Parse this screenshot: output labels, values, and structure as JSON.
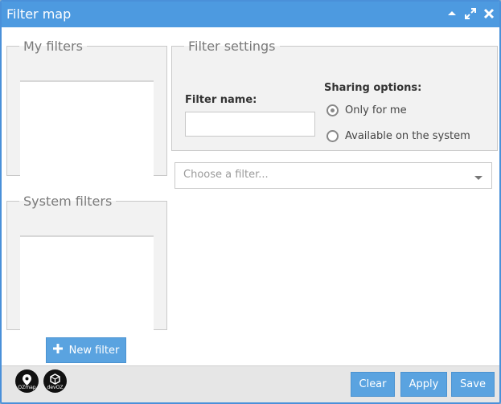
{
  "window": {
    "title": "Filter map"
  },
  "title_icons": [
    "minimize-icon",
    "maximize-icon",
    "close-icon"
  ],
  "my_filters": {
    "legend": "My filters"
  },
  "system_filters": {
    "legend": "System filters"
  },
  "filter_settings": {
    "legend": "Filter settings",
    "name_label": "Filter name:",
    "name_value": "",
    "sharing_label": "Sharing options:",
    "options": [
      {
        "label": "Only for me",
        "checked": true
      },
      {
        "label": "Available on the system",
        "checked": false
      }
    ]
  },
  "choose_filter": {
    "placeholder": "Choose a filter..."
  },
  "new_filter_label": "New filter",
  "footer": {
    "logos": [
      {
        "icon": "ozmap-icon",
        "text": "OZmap"
      },
      {
        "icon": "devoz-icon",
        "text": "devOZ"
      }
    ],
    "clear_label": "Clear",
    "apply_label": "Apply",
    "save_label": "Save"
  },
  "colors": {
    "accent": "#5aa3e0",
    "titlebar": "#4d9ae0"
  }
}
